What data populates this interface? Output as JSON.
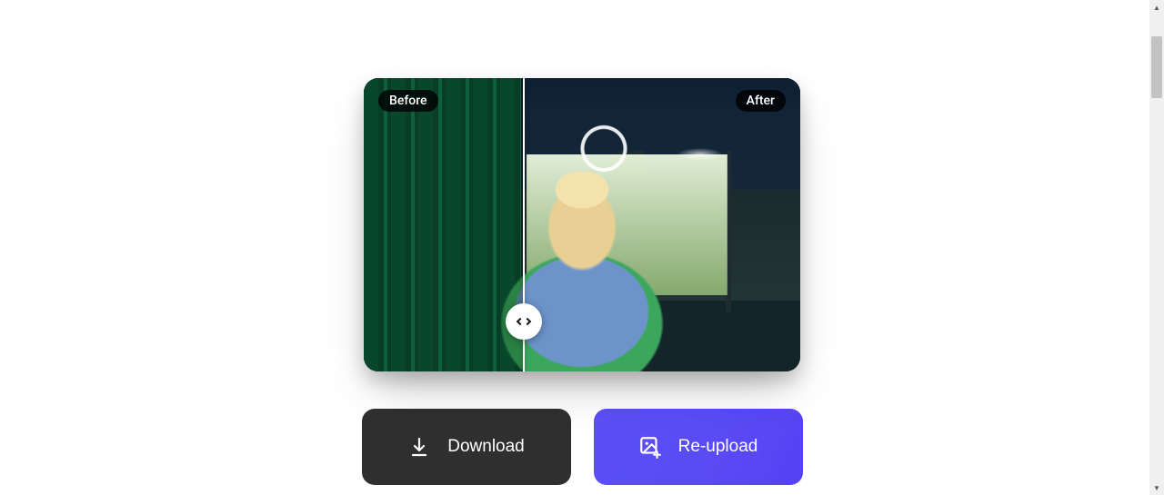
{
  "comparison": {
    "before_label": "Before",
    "after_label": "After"
  },
  "actions": {
    "download_label": "Download",
    "reupload_label": "Re-upload"
  }
}
